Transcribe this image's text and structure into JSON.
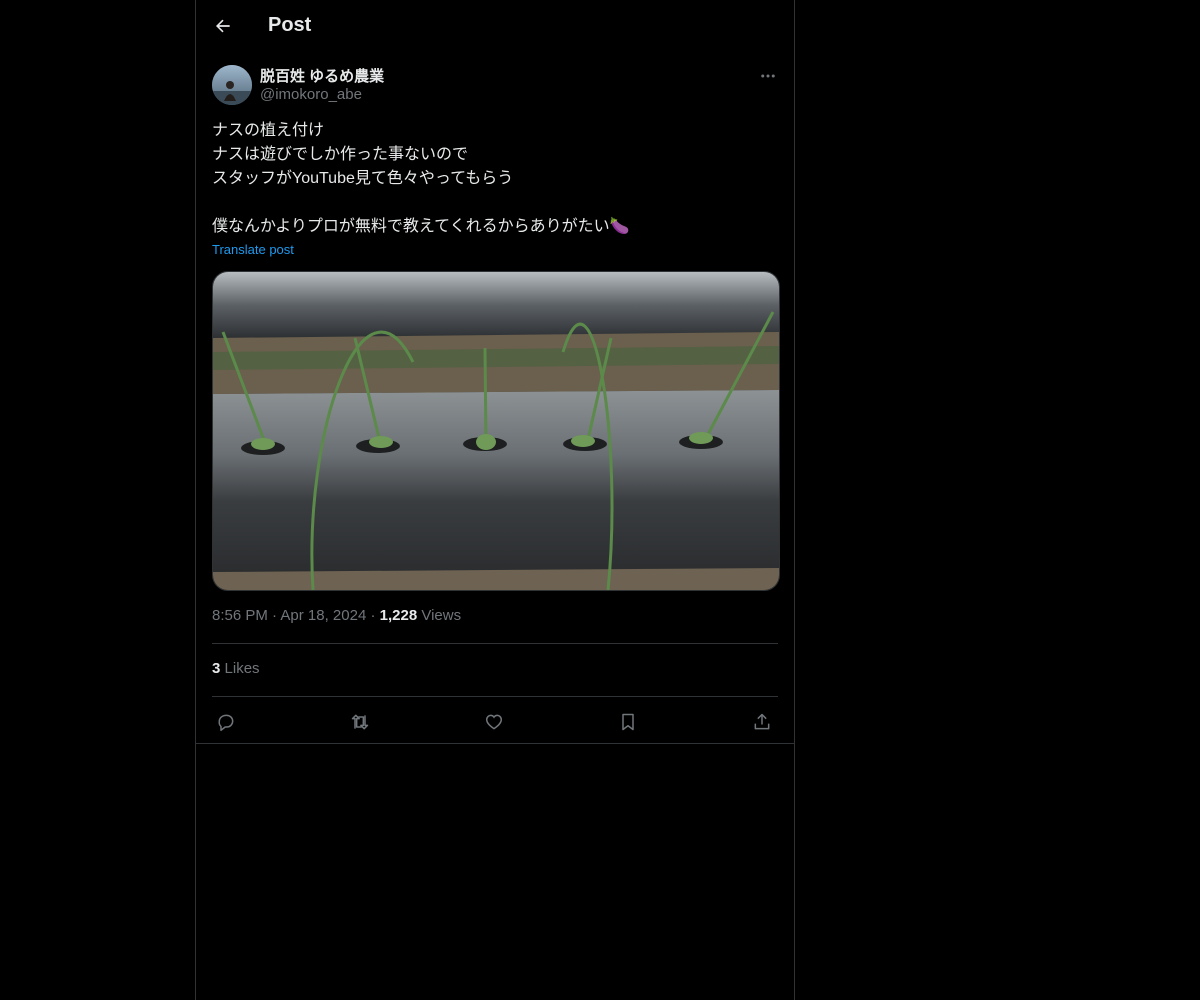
{
  "header": {
    "title": "Post"
  },
  "author": {
    "display_name": "脱百姓 ゆるめ農業",
    "handle": "@imokoro_abe"
  },
  "tweet": {
    "lines": [
      "ナスの植え付け",
      "ナスは遊びでしか作った事ないので",
      "スタッフがYouTube見て色々やってもらう",
      "",
      "僕なんかよりプロが無料で教えてくれるからありがたい🍆"
    ],
    "translate_label": "Translate post"
  },
  "meta": {
    "time": "8:56 PM",
    "separator": "·",
    "date": "Apr 18, 2024",
    "views_count": "1,228",
    "views_label": "Views"
  },
  "engagement": {
    "likes_count": "3",
    "likes_label": "Likes"
  },
  "icons": [
    "back-arrow-icon",
    "more-icon",
    "reply-icon",
    "retweet-icon",
    "like-icon",
    "bookmark-icon",
    "share-icon"
  ],
  "colors": {
    "background": "#000000",
    "text": "#e7e9ea",
    "muted": "#71767b",
    "link": "#1d9bf0",
    "border": "#2f3336"
  }
}
